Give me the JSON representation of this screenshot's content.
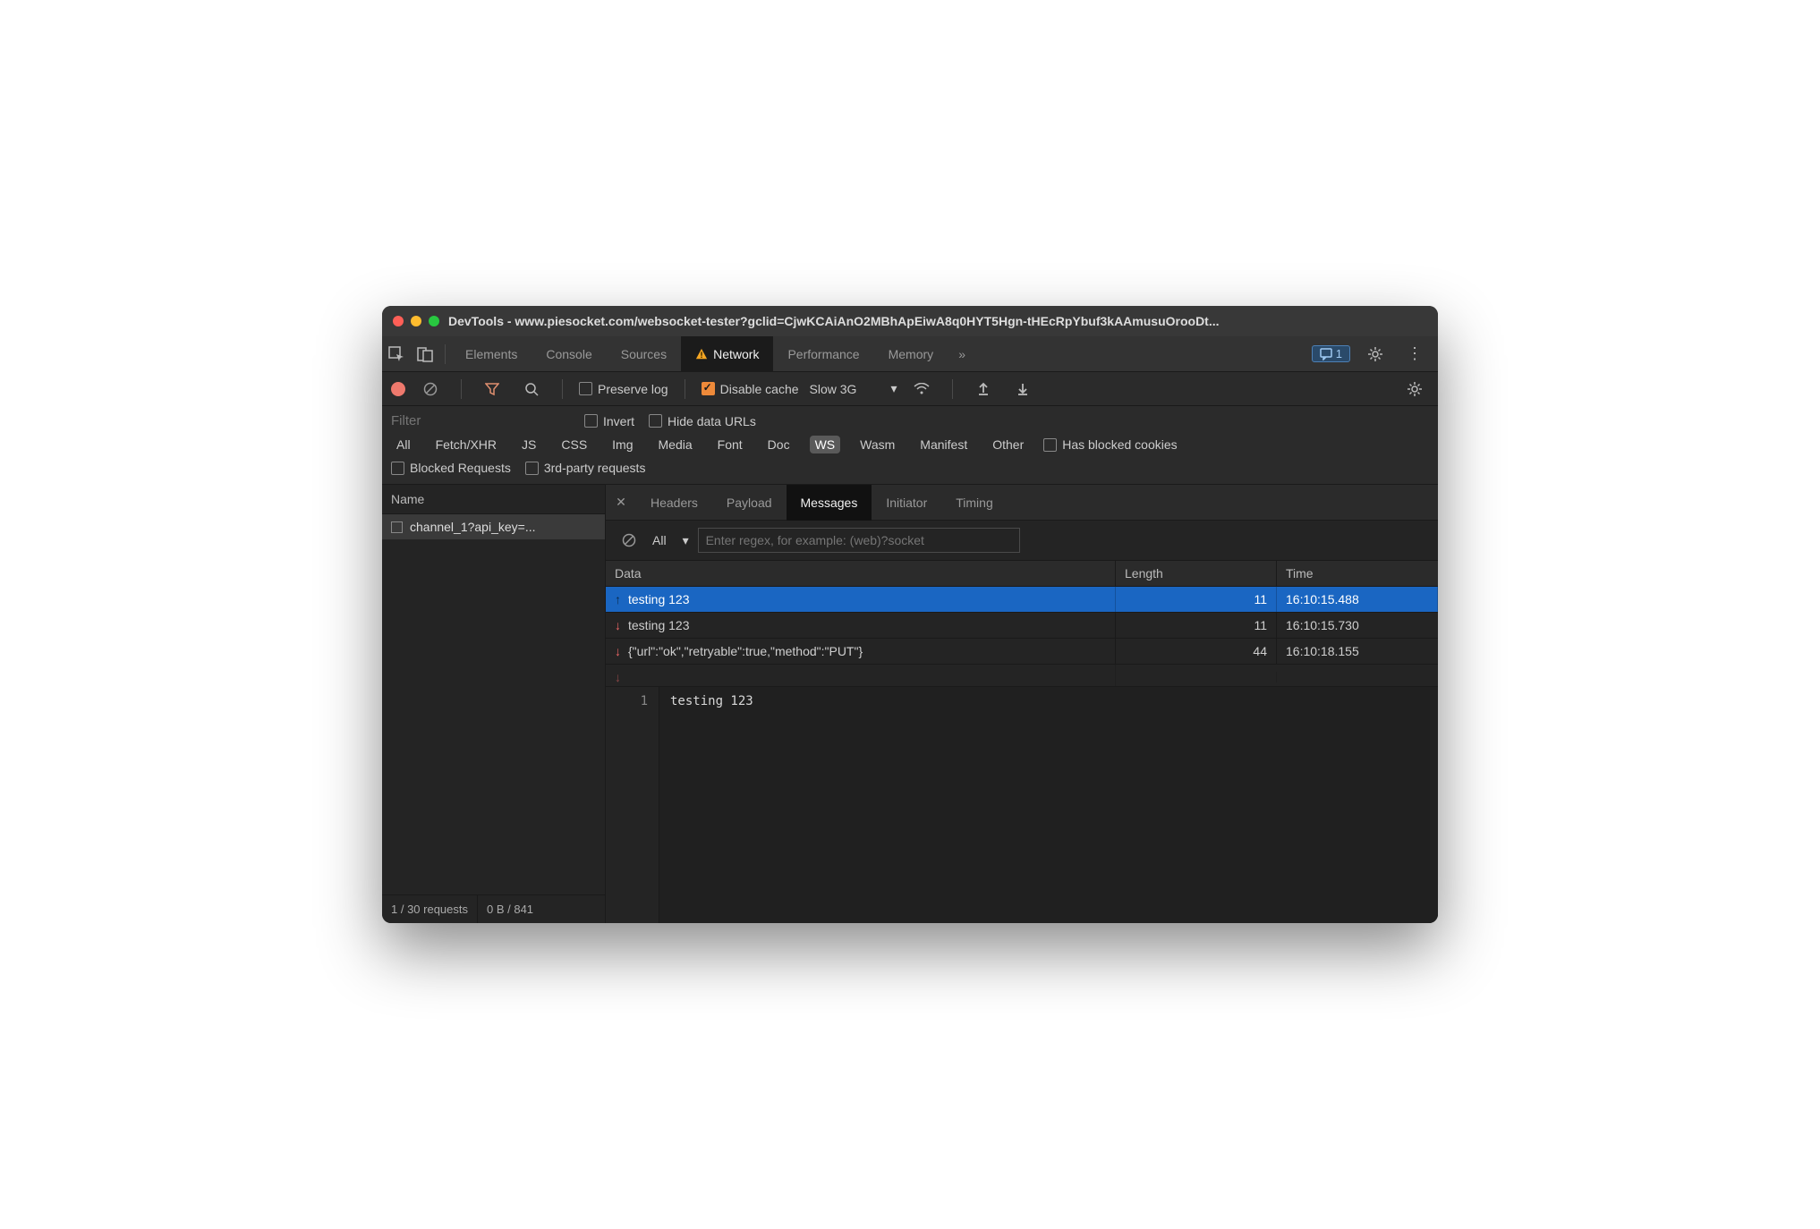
{
  "titlebar": {
    "title": "DevTools - www.piesocket.com/websocket-tester?gclid=CjwKCAiAnO2MBhApEiwA8q0HYT5Hgn-tHEcRpYbuf3kAAmusuOrooDt..."
  },
  "tabs": {
    "items": [
      "Elements",
      "Console",
      "Sources",
      "Network",
      "Performance",
      "Memory"
    ],
    "active": "Network",
    "badge_count": "1"
  },
  "toolbar": {
    "preserve_log": "Preserve log",
    "disable_cache": "Disable cache",
    "throttle": "Slow 3G"
  },
  "filterbar": {
    "filter_placeholder": "Filter",
    "invert": "Invert",
    "hide_data_urls": "Hide data URLs",
    "types": [
      "All",
      "Fetch/XHR",
      "JS",
      "CSS",
      "Img",
      "Media",
      "Font",
      "Doc",
      "WS",
      "Wasm",
      "Manifest",
      "Other"
    ],
    "active_type": "WS",
    "has_blocked": "Has blocked cookies",
    "blocked_requests": "Blocked Requests",
    "third_party": "3rd-party requests"
  },
  "sidebar": {
    "header": "Name",
    "row": "channel_1?api_key=...",
    "footer_left": "1 / 30 requests",
    "footer_right": "0 B / 841"
  },
  "detail": {
    "tabs": [
      "Headers",
      "Payload",
      "Messages",
      "Initiator",
      "Timing"
    ],
    "active": "Messages",
    "filter_all": "All",
    "regex_placeholder": "Enter regex, for example: (web)?socket",
    "columns": {
      "data": "Data",
      "length": "Length",
      "time": "Time"
    },
    "messages": [
      {
        "dir": "up",
        "text": "testing 123",
        "length": "11",
        "time": "16:10:15.488",
        "selected": true
      },
      {
        "dir": "down",
        "text": "testing 123",
        "length": "11",
        "time": "16:10:15.730",
        "selected": false
      },
      {
        "dir": "down",
        "text": "{\"url\":\"ok\",\"retryable\":true,\"method\":\"PUT\"}",
        "length": "44",
        "time": "16:10:18.155",
        "selected": false
      }
    ],
    "preview": {
      "line_no": "1",
      "content": "testing 123"
    }
  }
}
